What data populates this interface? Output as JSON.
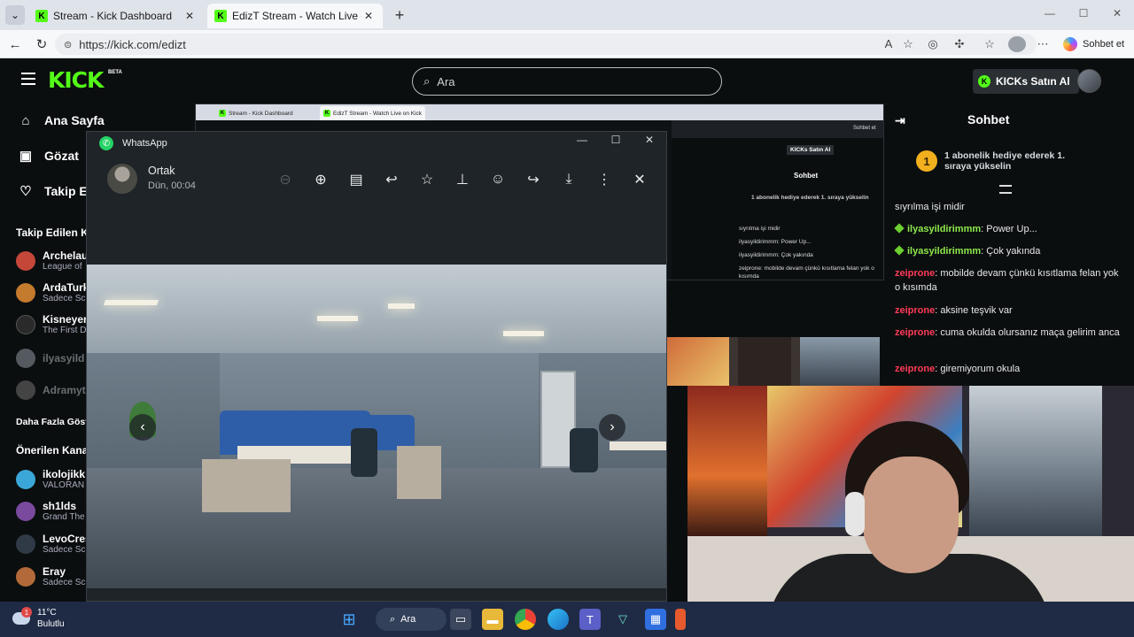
{
  "browser": {
    "tabs": [
      {
        "label": "Stream - Kick Dashboard",
        "active": false
      },
      {
        "label": "EdizT Stream - Watch Live on Kick",
        "active": true
      }
    ],
    "url": "https://kick.com/edizt",
    "copilot_label": "Sohbet et"
  },
  "kick": {
    "logo": "KICK",
    "beta": "BETA",
    "search_placeholder": "Ara",
    "buy_kicks": "KICKs Satın Al",
    "nav": {
      "home": "Ana Sayfa",
      "browse": "Gözat",
      "following": "Takip Et"
    },
    "followed_title": "Takip Edilen K",
    "followed": [
      {
        "name": "Archelau",
        "sub": "League of",
        "color": "#c5473a"
      },
      {
        "name": "ArdaTurk",
        "sub": "Sadece Sc",
        "color": "#c47b2e"
      },
      {
        "name": "Kisneyer",
        "sub": "The First D",
        "color": "#2a2a2a"
      },
      {
        "name": "ilyasyild",
        "sub": "",
        "color": "#555a60",
        "offline": true
      },
      {
        "name": "Adramyt",
        "sub": "",
        "color": "#444",
        "offline": true
      }
    ],
    "show_more": "Daha Fazla Göst",
    "recommended_title": "Önerilen Kana",
    "recommended": [
      {
        "name": "ikolojikk",
        "sub": "VALORAN",
        "color": "#3ba7d8"
      },
      {
        "name": "sh1lds",
        "sub": "Grand The",
        "color": "#7a4a9e"
      },
      {
        "name": "LevoCres",
        "sub": "Sadece Sc",
        "color": "#2f3a46"
      },
      {
        "name": "Eray",
        "sub": "Sadece Sc",
        "color": "#b36a3a"
      }
    ]
  },
  "chat": {
    "title": "Sohbet",
    "gift_banner": "1 abonelik hediye ederek 1. sıraya yükselin",
    "gift_rank": "1",
    "messages": [
      {
        "user": "",
        "text": "sıyrılma işi midir",
        "style": "none"
      },
      {
        "user": "ilyasyildirimmm",
        "text": ": Power Up...",
        "style": "green"
      },
      {
        "user": "ilyasyildirimmm",
        "text": ": Çok yakında",
        "style": "green"
      },
      {
        "user": "zeiprone",
        "text": ": mobilde devam çünkü kısıtlama felan yok o kısımda",
        "style": "red"
      },
      {
        "user": "zeiprone",
        "text": ": aksine teşvik var",
        "style": "red"
      },
      {
        "user": "zeiprone",
        "text": ": cuma okulda olursanız maça gelirim anca",
        "style": "red"
      },
      {
        "user": "zeiprone",
        "text": ": giremiyorum okula",
        "style": "red"
      }
    ]
  },
  "whatsapp": {
    "title": "WhatsApp",
    "contact": "Ortak",
    "timestamp": "Dün, 00:04",
    "tools": [
      "zoom-out-icon",
      "zoom-in-icon",
      "caption-icon",
      "reply-icon",
      "star-icon",
      "pin-icon",
      "emoji-icon",
      "forward-icon",
      "download-icon",
      "more-icon",
      "close-icon"
    ]
  },
  "taskbar": {
    "temp": "11°C",
    "weather": "Bulutlu",
    "weather_badge": "1",
    "search": "Ara"
  },
  "mini_chat": {
    "title": "Sohbet",
    "buy": "KICKs Satın Al",
    "gift": "1 abonelik hediye ederek 1. sıraya yükselin",
    "lines": [
      "sıyrılma işi midir",
      "ilyasyildirimmm: Power Up...",
      "ilyasyildirimmm: Çok yakında",
      "zeiprone: mobilde devam çünkü kısıtlama felan yok o kısımda",
      "zeiprone: aksine teşvik var",
      "zeiprone: cuma okulda olursanız maça gelirim anca",
      "zeiprone: giremiyorum okula"
    ]
  },
  "embed_tabs": [
    "Stream - Kick Dashboard",
    "EdizT Stream - Watch Live on Kick"
  ],
  "embed_copilot": "Sohbet et"
}
